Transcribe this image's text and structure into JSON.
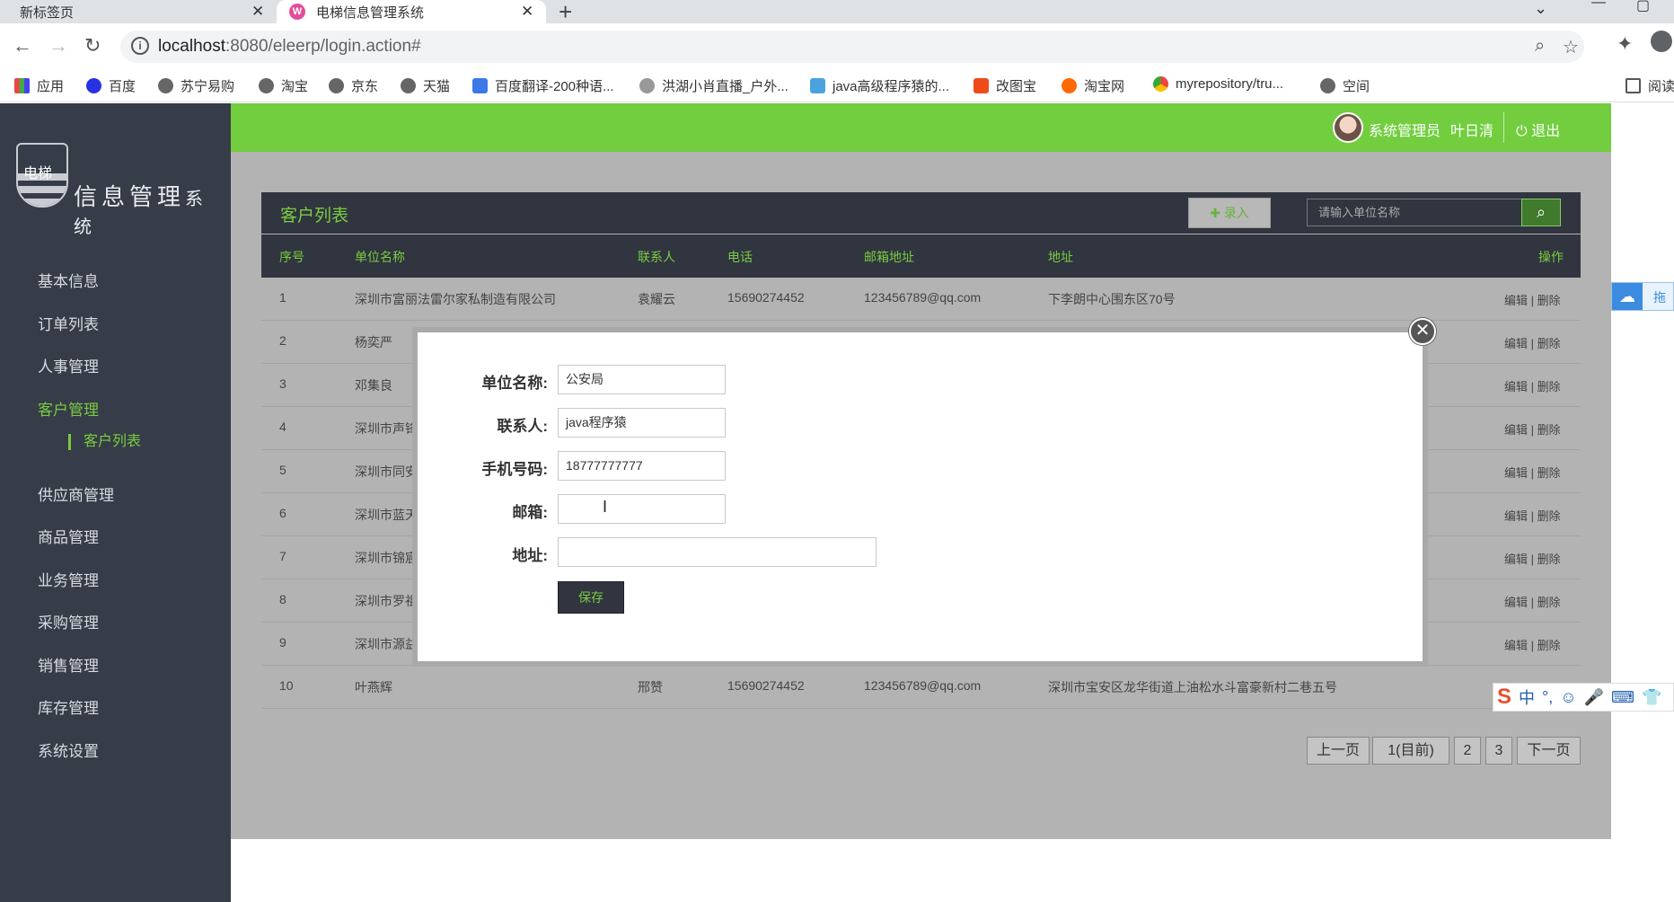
{
  "browser": {
    "tabs": [
      {
        "label": "新标签页",
        "active": false
      },
      {
        "label": "电梯信息管理系统",
        "active": true
      }
    ],
    "url_host": "localhost",
    "url_rest": ":8080/eleerp/login.action#",
    "bookmarks": [
      "应用",
      "百度",
      "苏宁易购",
      "淘宝",
      "京东",
      "天猫",
      "百度翻译-200种语...",
      "洪湖小肖直播_户外...",
      "java高级程序猿的...",
      "改图宝",
      "淘宝网",
      "myrepository/tru...",
      "空间",
      "阅读"
    ]
  },
  "app": {
    "logo_shield_text": "电梯",
    "logo_title": "信息管理",
    "logo_title_small": "系统",
    "menu": [
      "基本信息",
      "订单列表",
      "人事管理",
      "客户管理",
      "供应商管理",
      "商品管理",
      "业务管理",
      "采购管理",
      "销售管理",
      "库存管理",
      "系统设置"
    ],
    "active_menu": "客户管理",
    "submenu": "客户列表",
    "user_role": "系统管理员",
    "user_name": "叶日清",
    "logout": "退出"
  },
  "list": {
    "title": "客户列表",
    "add_label": "录入",
    "search_placeholder": "请输入单位名称",
    "columns": [
      "序号",
      "单位名称",
      "联系人",
      "电话",
      "邮箱地址",
      "地址",
      "操作"
    ],
    "rows": [
      {
        "no": "1",
        "name": "深圳市富丽法雷尔家私制造有限公司",
        "contact": "袁耀云",
        "phone": "15690274452",
        "email": "123456789@qq.com",
        "address": "下李朗中心围东区70号"
      },
      {
        "no": "2",
        "name": "杨奕严",
        "contact": "",
        "phone": "",
        "email": "",
        "address": ""
      },
      {
        "no": "3",
        "name": "邓集良",
        "contact": "",
        "phone": "",
        "email": "",
        "address": ""
      },
      {
        "no": "4",
        "name": "深圳市声锋",
        "contact": "",
        "phone": "",
        "email": "",
        "address": ""
      },
      {
        "no": "5",
        "name": "深圳市同安",
        "contact": "",
        "phone": "",
        "email": "",
        "address": ""
      },
      {
        "no": "6",
        "name": "深圳市蓝天",
        "contact": "",
        "phone": "",
        "email": "",
        "address": ""
      },
      {
        "no": "7",
        "name": "深圳市锦宸",
        "contact": "",
        "phone": "",
        "email": "",
        "address": ""
      },
      {
        "no": "8",
        "name": "深圳市罗祖",
        "contact": "",
        "phone": "",
        "email": "",
        "address": ""
      },
      {
        "no": "9",
        "name": "深圳市源益",
        "contact": "",
        "phone": "",
        "email": "",
        "address": ""
      },
      {
        "no": "10",
        "name": "叶燕辉",
        "contact": "邢赞",
        "phone": "15690274452",
        "email": "123456789@qq.com",
        "address": "深圳市宝安区龙华街道上油松水斗富豪新村二巷五号"
      }
    ],
    "ops_label": "编辑 | 删除",
    "pager": [
      "上一页",
      "1(目前)",
      "2",
      "3",
      "下一页"
    ]
  },
  "modal": {
    "fields": [
      {
        "label": "单位名称:",
        "value": "公安局"
      },
      {
        "label": "联系人:",
        "value": "java程序猿"
      },
      {
        "label": "手机号码:",
        "value": "18777777777"
      },
      {
        "label": "邮箱:",
        "value": ""
      },
      {
        "label": "地址:",
        "value": ""
      }
    ],
    "save_label": "保存"
  },
  "widgets": {
    "cloud_label": "拖",
    "ime": [
      "中",
      "°,",
      "☺",
      "🎤",
      "⌨",
      "👕"
    ]
  },
  "colors": {
    "accent": "#72ce3f",
    "sidebar": "#363c48",
    "table_dark": "#30353f"
  }
}
